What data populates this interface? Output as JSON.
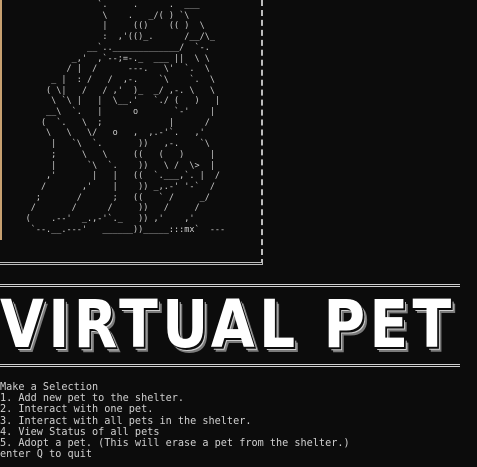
{
  "ascii_art": "                   `.     .      .  ___\n                    \\    .   _/( ) `\\\n                    |     (()    (( )  \\\n                    :  ,'(()_.      /__/\\_\n                 __`.._____________/  `-.\n              _,'  ,`--;=-._  ___ ||  \\ \\\n             / |  /      ---.   \\'  `.  \\\n          _ |  : /   /  ,-.    `\\    `.  \\\n         ( \\|   /   / ,'  )_  _/ ,-. \\   \\\n          \\ `\\ |   |  \\__.'   `./ (   )   |\n         __\\  `.   |      o       `-'    |\n        (  `.   \\  ;             |      /\n         \\   \\   \\/   o   ,  ,.-'`.   ,'\n          |   `\\  `.       ))   ,-.    `\\\n          ;     \\   \\     ((   (   )     |\n          |      `\\  `.    ))   \\ /  \\>  |\n         ,'       |   |   ((  `.___,`. |  /\n        /       ,'    |    )) _,.-' '-`  /\n       ;       /      ;   ((   ` /     _/\n      /       /      /     ))   /     /\n     (    .--'  _.,-'`._   )) ,'    ,'\n      `--.__.---'   ______))_____:::mx`  ---",
  "banner": {
    "title": "VIRTUAL PET"
  },
  "menu": {
    "heading": "Make a Selection",
    "options": [
      "1. Add new pet to the shelter.",
      "2. Interact with one pet.",
      "3. Interact with all pets in the shelter.",
      "4. View Status of all pets",
      "5. Adopt a pet. (This will erase a pet from the shelter.)"
    ],
    "quit_prompt": "enter Q to quit"
  }
}
